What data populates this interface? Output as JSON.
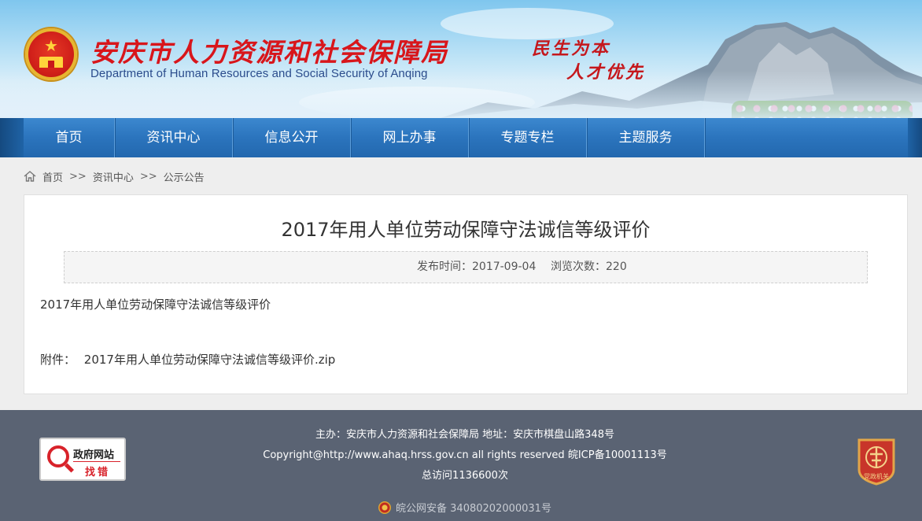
{
  "header": {
    "title": "安庆市人力资源和社会保障局",
    "subtitle": "Department of Human Resources and Social Security of Anqing",
    "slogan_line1": "民生为本",
    "slogan_line2": "人才优先"
  },
  "nav": {
    "items": [
      {
        "label": "首页"
      },
      {
        "label": "资讯中心"
      },
      {
        "label": "信息公开"
      },
      {
        "label": "网上办事"
      },
      {
        "label": "专题专栏"
      },
      {
        "label": "主题服务"
      }
    ]
  },
  "breadcrumb": {
    "home": "首页",
    "sep1": ">>",
    "section": "资讯中心",
    "sep2": ">>",
    "current": "公示公告"
  },
  "article": {
    "title": "2017年用人单位劳动保障守法诚信等级评价",
    "publish_time": "发布时间：2017-09-04",
    "views": "浏览次数：220",
    "body": "2017年用人单位劳动保障守法诚信等级评价",
    "attachment_label": "附件：",
    "attachment_file": "2017年用人单位劳动保障守法诚信等级评价.zip"
  },
  "footer": {
    "line1": "主办：安庆市人力资源和社会保障局 地址：安庆市棋盘山路348号",
    "line2": "Copyright@http://www.ahaq.hrss.gov.cn all rights reserved 皖ICP备10001113号",
    "line3": "总访问1136600次",
    "police": "皖公网安备 34080202000031号",
    "find_error_title": "政府网站",
    "find_error_action": "找错",
    "badge_text": "党政机关"
  },
  "colors": {
    "nav_bg": "#2b74bd",
    "title_red": "#d8161b",
    "footer_bg": "#5a6373"
  }
}
